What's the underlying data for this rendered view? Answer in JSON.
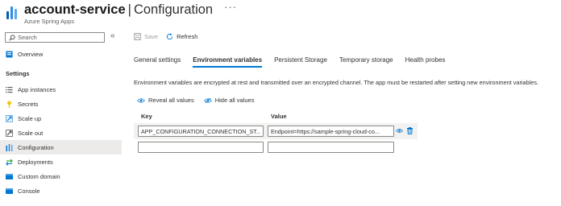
{
  "header": {
    "resource_name": "account-service",
    "separator": "|",
    "page_name": "Configuration",
    "more": "···",
    "subtitle": "Azure Spring Apps"
  },
  "sidebar": {
    "search_placeholder": "Search",
    "collapse_glyph": "«",
    "overview": "Overview",
    "section_settings": "Settings",
    "items": [
      {
        "label": "App instances",
        "icon": "list-icon"
      },
      {
        "label": "Secrets",
        "icon": "key-icon"
      },
      {
        "label": "Scale up",
        "icon": "scale-up-icon"
      },
      {
        "label": "Scale out",
        "icon": "scale-out-icon"
      },
      {
        "label": "Configuration",
        "icon": "configuration-icon",
        "active": true
      },
      {
        "label": "Deployments",
        "icon": "deployments-icon"
      },
      {
        "label": "Custom domain",
        "icon": "custom-domain-icon"
      },
      {
        "label": "Console",
        "icon": "console-icon"
      }
    ]
  },
  "toolbar": {
    "save_label": "Save",
    "refresh_label": "Refresh"
  },
  "tabs": [
    {
      "label": "General settings"
    },
    {
      "label": "Environment variables",
      "active": true
    },
    {
      "label": "Persistent Storage"
    },
    {
      "label": "Temporary storage"
    },
    {
      "label": "Health probes"
    }
  ],
  "info_text": "Environment variables are encrypted at rest and transmitted over an encrypted channel. The app must be restarted after setting new environment variables.",
  "actions": {
    "reveal_all": "Reveal all values",
    "hide_all": "Hide all values"
  },
  "table": {
    "key_header": "Key",
    "value_header": "Value",
    "rows": [
      {
        "key": "APP_CONFIGURATION_CONNECTION_ST...",
        "value": "Endpoint=https://sample-spring-cloud-co..."
      }
    ],
    "empty_key": "",
    "empty_value": ""
  },
  "colors": {
    "accent": "#0078d4",
    "active_nav_bg": "#edebe9",
    "row_bg": "#f3f2f1"
  }
}
